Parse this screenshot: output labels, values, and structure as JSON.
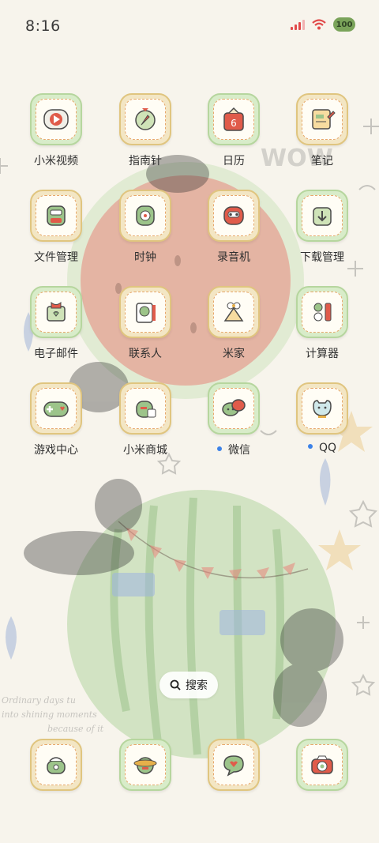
{
  "status_bar": {
    "time": "8:16",
    "battery": "100",
    "icons": [
      "signal-icon",
      "wifi-icon",
      "battery-icon"
    ]
  },
  "apps": [
    {
      "label": "小米视频",
      "icon": "video-icon"
    },
    {
      "label": "指南针",
      "icon": "compass-icon"
    },
    {
      "label": "日历",
      "icon": "calendar-icon",
      "badge_text": "6"
    },
    {
      "label": "笔记",
      "icon": "notes-icon"
    },
    {
      "label": "文件管理",
      "icon": "file-manager-icon"
    },
    {
      "label": "时钟",
      "icon": "clock-icon"
    },
    {
      "label": "录音机",
      "icon": "recorder-icon"
    },
    {
      "label": "下载管理",
      "icon": "download-icon"
    },
    {
      "label": "电子邮件",
      "icon": "email-icon"
    },
    {
      "label": "联系人",
      "icon": "contacts-icon"
    },
    {
      "label": "米家",
      "icon": "mijia-icon"
    },
    {
      "label": "计算器",
      "icon": "calculator-icon"
    },
    {
      "label": "游戏中心",
      "icon": "game-center-icon"
    },
    {
      "label": "小米商城",
      "icon": "mi-store-icon"
    },
    {
      "label": "微信",
      "icon": "wechat-icon",
      "new": true
    },
    {
      "label": "QQ",
      "icon": "qq-icon",
      "new": true
    }
  ],
  "search": {
    "label": "搜索"
  },
  "dock": [
    {
      "icon": "phone-icon"
    },
    {
      "icon": "browser-icon"
    },
    {
      "icon": "messages-icon"
    },
    {
      "icon": "camera-icon"
    }
  ],
  "wallpaper": {
    "text_lines": [
      "Ordinary days tu",
      "into shining moments",
      "because of it"
    ],
    "wow_text": "WOW"
  },
  "colors": {
    "background": "#f7f4ec",
    "watermelon_red": "#e8867c",
    "watermelon_green": "#9cc48a",
    "new_dot": "#3c82e8"
  }
}
